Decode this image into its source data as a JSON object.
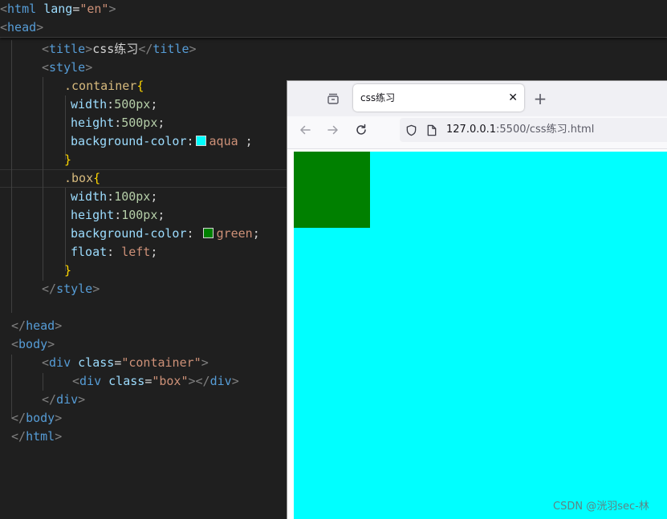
{
  "editor": {
    "lines": {
      "l1": {
        "lt": "<",
        "tag": "html",
        "sp": " ",
        "attr": "lang",
        "eq": "=",
        "str": "\"en\"",
        "gt": ">"
      },
      "l2": {
        "lt": "<",
        "tag": "head",
        "gt": ">"
      },
      "l3": {
        "lt1": "<",
        "tag1": "title",
        "gt1": ">",
        "text": "css练习",
        "lt2": "</",
        "tag2": "title",
        "gt2": ">"
      },
      "l4": {
        "lt": "<",
        "tag": "style",
        "gt": ">"
      },
      "l5": {
        "sel": ".container",
        "br": "{"
      },
      "l6": {
        "prop": "width",
        "colon": ":",
        "num": "500px",
        "semi": ";"
      },
      "l7": {
        "prop": "height",
        "colon": ":",
        "num": "500px",
        "semi": ";"
      },
      "l8": {
        "prop": "background-color",
        "colon": ":",
        "val": "aqua",
        "semi": " ;"
      },
      "l9": {
        "br": "}"
      },
      "l10": {
        "sel": ".box",
        "br": "{"
      },
      "l11": {
        "prop": "width",
        "colon": ":",
        "num": "100px",
        "semi": ";"
      },
      "l12": {
        "prop": "height",
        "colon": ":",
        "num": "100px",
        "semi": ";"
      },
      "l13": {
        "prop": "background-color",
        "colon": ": ",
        "val": "green",
        "semi": ";"
      },
      "l14": {
        "prop": "float",
        "colon": ": ",
        "val": "left",
        "semi": ";"
      },
      "l15": {
        "br": "}"
      },
      "l16": {
        "lt": "</",
        "tag": "style",
        "gt": ">"
      },
      "l18": {
        "lt": "</",
        "tag": "head",
        "gt": ">"
      },
      "l19": {
        "lt": "<",
        "tag": "body",
        "gt": ">"
      },
      "l20": {
        "lt": "<",
        "tag": "div",
        "sp": " ",
        "attr": "class",
        "eq": "=",
        "str": "\"container\"",
        "gt": ">"
      },
      "l21": {
        "lt1": "<",
        "tag1": "div",
        "sp": " ",
        "attr": "class",
        "eq": "=",
        "str": "\"box\"",
        "gt1": ">",
        "lt2": "</",
        "tag2": "div",
        "gt2": ">"
      },
      "l22": {
        "lt": "</",
        "tag": "div",
        "gt": ">"
      },
      "l23": {
        "lt": "</",
        "tag": "body",
        "gt": ">"
      },
      "l24": {
        "lt": "</",
        "tag": "html",
        "gt": ">"
      }
    },
    "swatch_colors": {
      "aqua": "#00ffff",
      "green": "#008000"
    }
  },
  "browser": {
    "tab_title": "css练习",
    "tab_close": "✕",
    "new_tab": "+",
    "url_host": "127.0.0.1",
    "url_rest": ":5500/css练习.html",
    "container_color": "#00ffff",
    "box_color": "#008000"
  },
  "watermark": "CSDN @洸羽sec-林"
}
